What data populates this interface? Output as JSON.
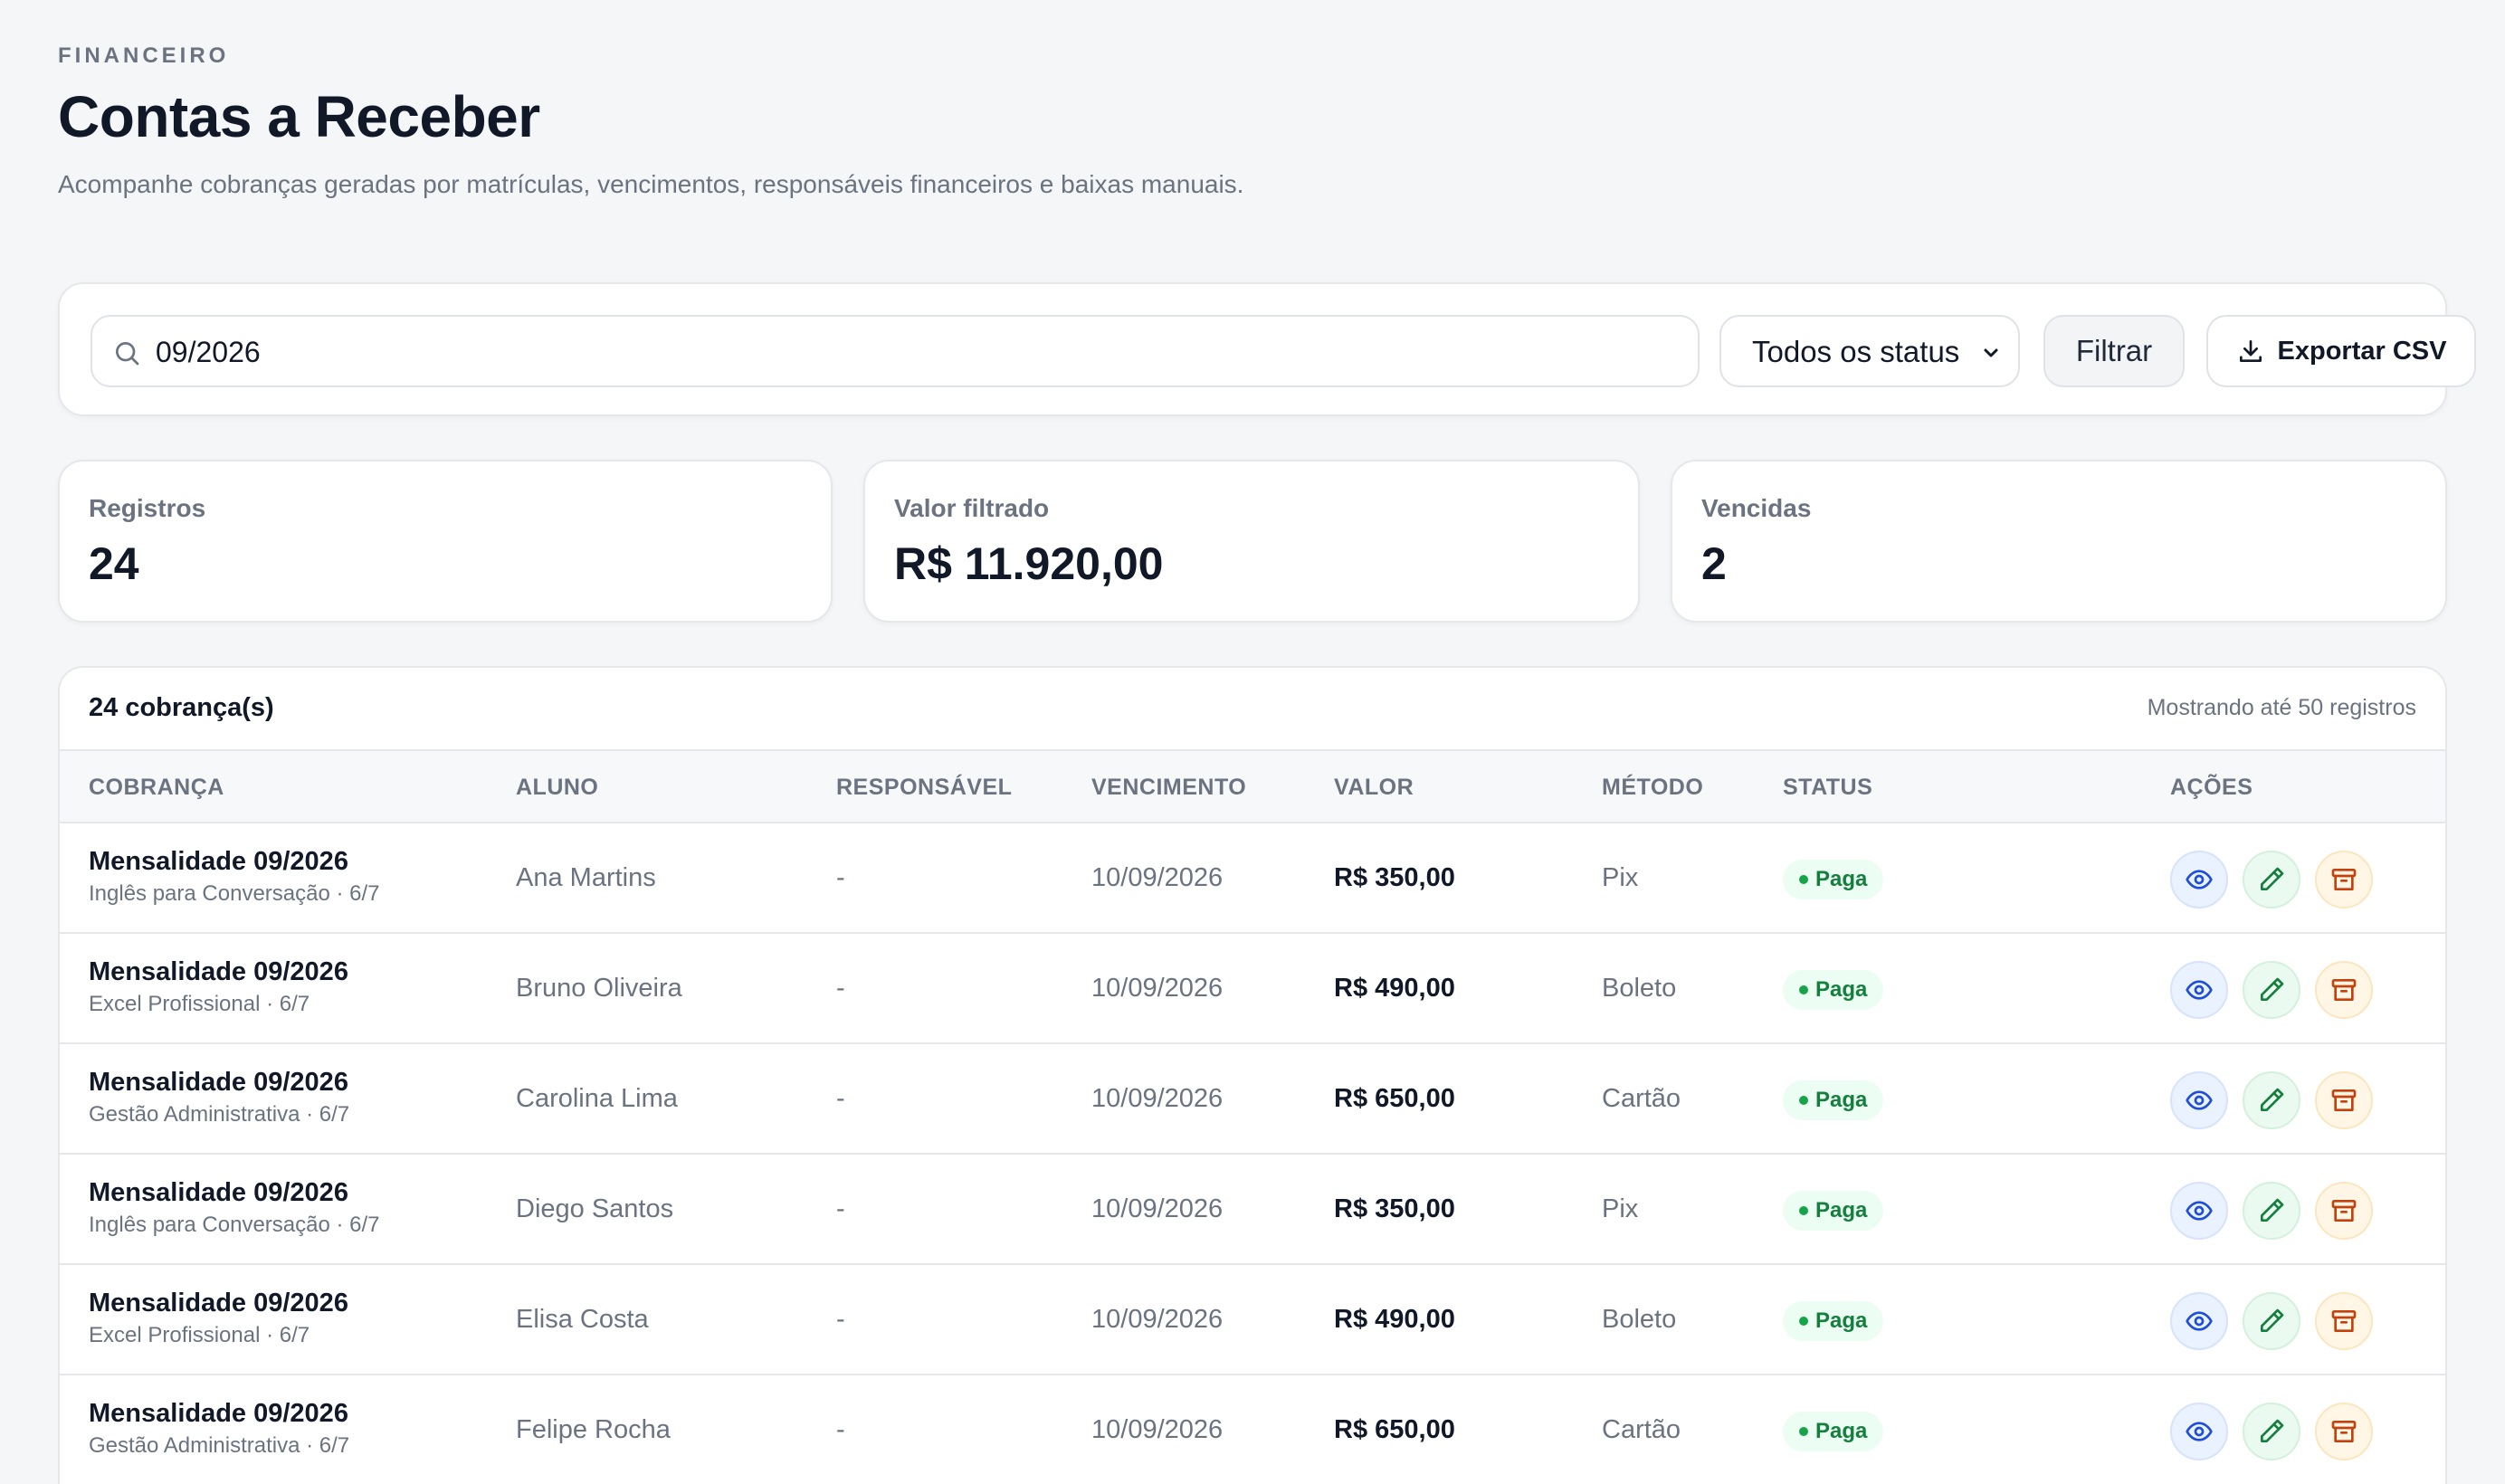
{
  "header": {
    "eyebrow": "FINANCEIRO",
    "title": "Contas a Receber",
    "description": "Acompanhe cobranças geradas por matrículas, vencimentos, responsáveis financeiros e baixas manuais."
  },
  "filters": {
    "search_value": "09/2026",
    "status_selected": "Todos os status",
    "filter_label": "Filtrar",
    "export_label": "Exportar CSV"
  },
  "stats": [
    {
      "label": "Registros",
      "value": "24"
    },
    {
      "label": "Valor filtrado",
      "value": "R$ 11.920,00"
    },
    {
      "label": "Vencidas",
      "value": "2"
    }
  ],
  "table": {
    "count_label": "24 cobrança(s)",
    "note": "Mostrando até 50 registros",
    "columns": [
      "COBRANÇA",
      "ALUNO",
      "RESPONSÁVEL",
      "VENCIMENTO",
      "VALOR",
      "MÉTODO",
      "STATUS",
      "AÇÕES"
    ],
    "rows": [
      {
        "title": "Mensalidade 09/2026",
        "subtitle": "Inglês para Conversação · 6/7",
        "aluno": "Ana Martins",
        "responsavel": "-",
        "vencimento": "10/09/2026",
        "valor": "R$ 350,00",
        "metodo": "Pix",
        "status": "Paga"
      },
      {
        "title": "Mensalidade 09/2026",
        "subtitle": "Excel Profissional · 6/7",
        "aluno": "Bruno Oliveira",
        "responsavel": "-",
        "vencimento": "10/09/2026",
        "valor": "R$ 490,00",
        "metodo": "Boleto",
        "status": "Paga"
      },
      {
        "title": "Mensalidade 09/2026",
        "subtitle": "Gestão Administrativa · 6/7",
        "aluno": "Carolina Lima",
        "responsavel": "-",
        "vencimento": "10/09/2026",
        "valor": "R$ 650,00",
        "metodo": "Cartão",
        "status": "Paga"
      },
      {
        "title": "Mensalidade 09/2026",
        "subtitle": "Inglês para Conversação · 6/7",
        "aluno": "Diego Santos",
        "responsavel": "-",
        "vencimento": "10/09/2026",
        "valor": "R$ 350,00",
        "metodo": "Pix",
        "status": "Paga"
      },
      {
        "title": "Mensalidade 09/2026",
        "subtitle": "Excel Profissional · 6/7",
        "aluno": "Elisa Costa",
        "responsavel": "-",
        "vencimento": "10/09/2026",
        "valor": "R$ 490,00",
        "metodo": "Boleto",
        "status": "Paga"
      },
      {
        "title": "Mensalidade 09/2026",
        "subtitle": "Gestão Administrativa · 6/7",
        "aluno": "Felipe Rocha",
        "responsavel": "-",
        "vencimento": "10/09/2026",
        "valor": "R$ 650,00",
        "metodo": "Cartão",
        "status": "Paga"
      }
    ]
  },
  "icons": {
    "search": "search-icon",
    "chevron": "chevron-down-icon",
    "export": "download-icon",
    "view": "eye-icon",
    "edit": "pencil-icon",
    "archive": "archive-icon"
  },
  "colors": {
    "status_paid_bg": "#ecfdf3",
    "status_paid_text": "#15803d",
    "view_icon": "#1d4ed8",
    "edit_icon": "#15803d",
    "archive_icon": "#c2410c"
  }
}
